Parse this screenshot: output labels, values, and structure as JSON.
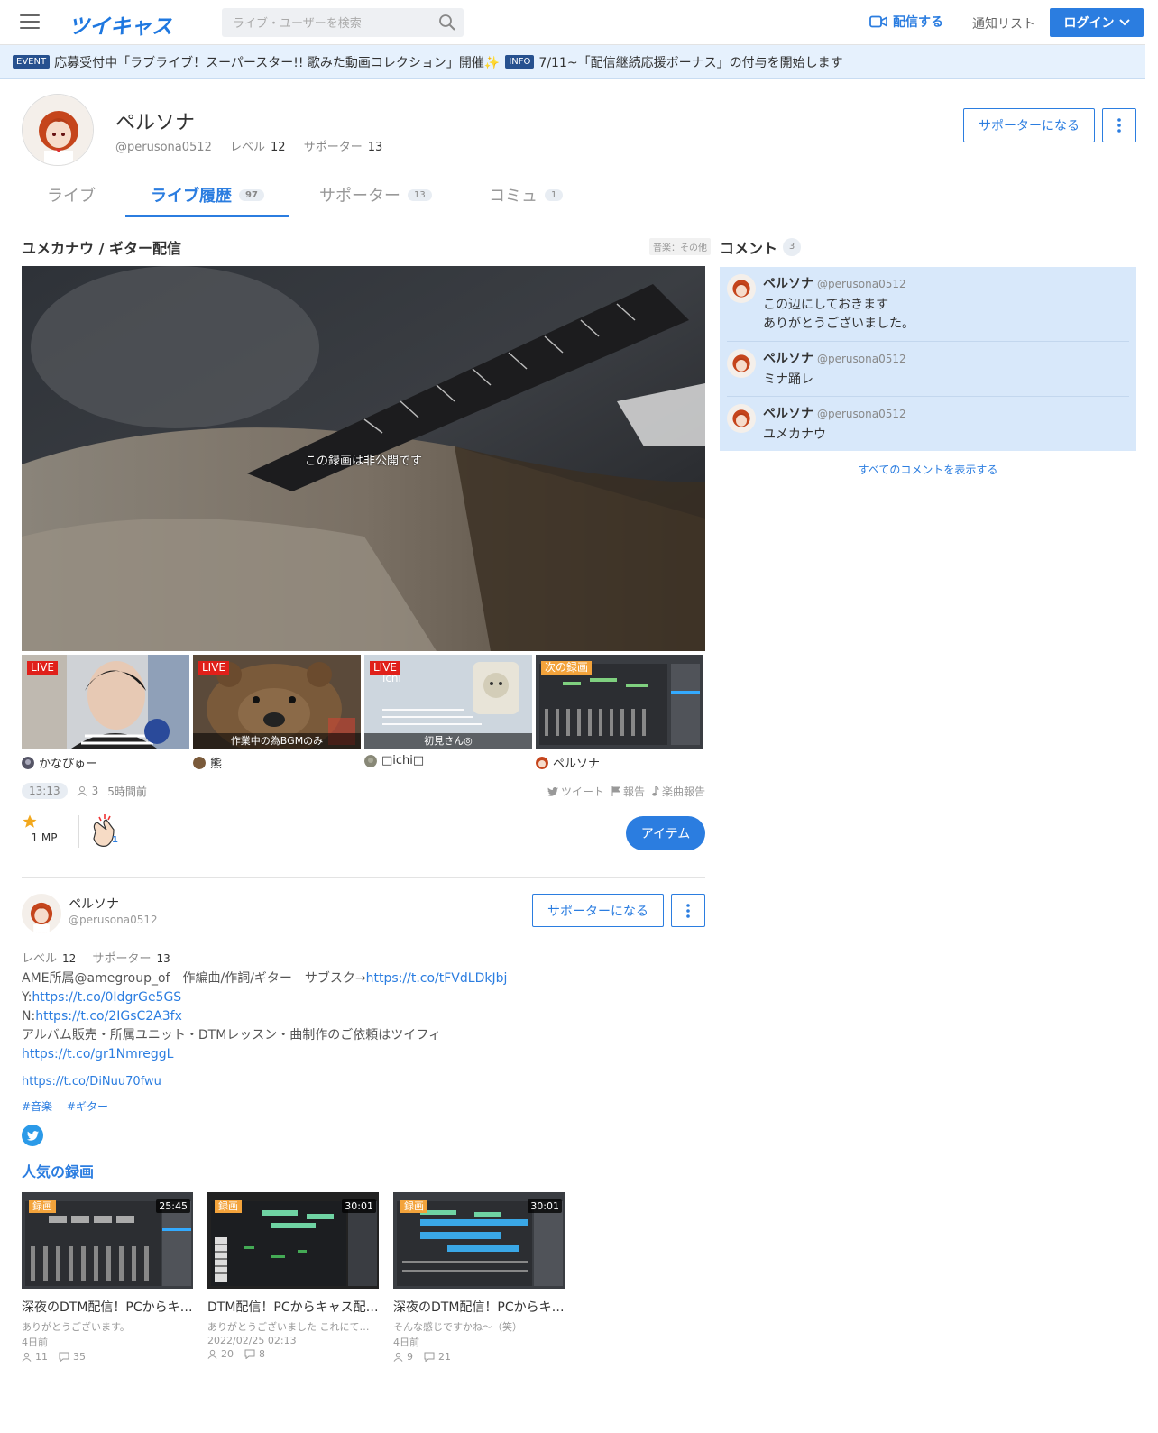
{
  "header": {
    "logo": "ツイキャス",
    "search_placeholder": "ライブ・ユーザーを検索",
    "broadcast": "配信する",
    "notify": "通知リスト",
    "login": "ログイン"
  },
  "news": [
    {
      "tag": "EVENT",
      "text": "応募受付中「ラブライブ！スーパースター!! 歌みた動画コレクション」開催✨"
    },
    {
      "tag": "INFO",
      "text": "7/11~「配信継続応援ボーナス」の付与を開始します"
    }
  ],
  "profile": {
    "name": "ペルソナ",
    "id": "@perusona0512",
    "level_label": "レベル",
    "level": "12",
    "supporter_label": "サポーター",
    "supporters": "13",
    "support_button": "サポーターになる"
  },
  "tabs": [
    {
      "label": "ライブ",
      "count": ""
    },
    {
      "label": "ライブ履歴",
      "count": "97"
    },
    {
      "label": "サポーター",
      "count": "13"
    },
    {
      "label": "コミュ",
      "count": "1"
    }
  ],
  "movie": {
    "title": "ユメカナウ / ギター配信",
    "category": "音楽：その他",
    "private_message": "この録画は非公開です",
    "duration": "13:13",
    "viewers": "3",
    "ago": "5時間前",
    "tweet": "ツイート",
    "report": "報告",
    "song_report": "楽曲報告",
    "mp": "1 MP",
    "clap_count": "1",
    "item_button": "アイテム"
  },
  "thumbs": [
    {
      "badge": "LIVE",
      "caption": "",
      "user": "かなぴゅー"
    },
    {
      "badge": "LIVE",
      "caption": "作業中の為BGMのみ",
      "user": "熊"
    },
    {
      "badge": "LIVE",
      "caption": "初見さん◎",
      "user": "□ichi□"
    },
    {
      "badge": "次の録画",
      "caption": "",
      "user": "ペルソナ"
    }
  ],
  "user_box": {
    "name": "ペルソナ",
    "id": "@perusona0512",
    "level_label": "レベル",
    "level": "12",
    "supporter_label": "サポーター",
    "supporters": "13",
    "support_button": "サポーターになる",
    "bio_line1": "AME所属@amegroup_of　作編曲/作詞/ギター　サブスク→",
    "bio_link1": "https://t.co/tFVdLDkJbj",
    "bio_y": "Y:",
    "bio_link_y": "https://t.co/0IdgrGe5GS",
    "bio_n": "N:",
    "bio_link_n": "https://t.co/2IGsC2A3fx",
    "bio_line4": "アルバム販売・所属ユニット・DTMレッスン・曲制作のご依頼はツイフィ",
    "bio_link5": "https://t.co/gr1NmreggL",
    "link": "https://t.co/DiNuu70fwu",
    "tags": [
      "#音楽",
      "#ギター"
    ]
  },
  "popular": {
    "title": "人気の録画",
    "items": [
      {
        "badge": "録画",
        "time": "25:45",
        "title": "深夜のDTM配信！PCからキャス配信",
        "sub": "ありがとうございます。",
        "date": "4日前",
        "views": "11",
        "comments": "35"
      },
      {
        "badge": "録画",
        "time": "30:01",
        "title": "DTM配信！PCからキャス配信テスト",
        "sub": "ありがとうございました これにて終了です",
        "date": "2022/02/25 02:13",
        "views": "20",
        "comments": "8"
      },
      {
        "badge": "録画",
        "time": "30:01",
        "title": "深夜のDTM配信！PCからキャス配信",
        "sub": "そんな感じですかね～（笑）",
        "date": "4日前",
        "views": "9",
        "comments": "21"
      }
    ]
  },
  "comments": {
    "title": "コメント",
    "count": "3",
    "items": [
      {
        "name": "ペルソナ",
        "id": "@perusona0512",
        "text": "この辺にしておきます\nありがとうございました。"
      },
      {
        "name": "ペルソナ",
        "id": "@perusona0512",
        "text": "ミナ踊レ"
      },
      {
        "name": "ペルソナ",
        "id": "@perusona0512",
        "text": "ユメカナウ"
      }
    ],
    "show_all": "すべてのコメントを表示する"
  }
}
